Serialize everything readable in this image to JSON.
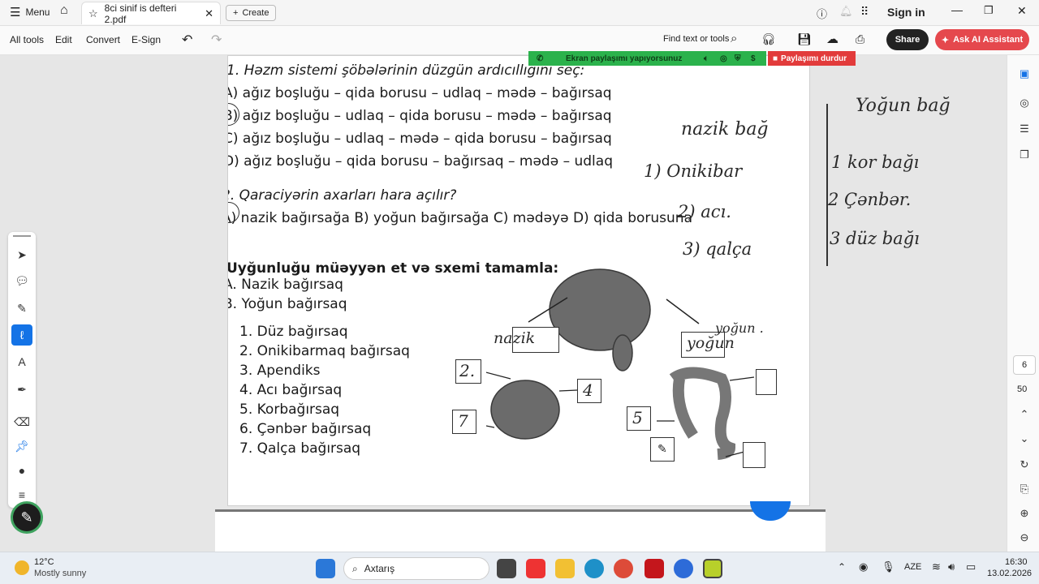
{
  "titlebar": {
    "menu_label": "Menu",
    "tab_title": "8ci sinif is defteri 2.pdf",
    "create_label": "Create",
    "sign_in": "Sign in"
  },
  "toolbar": {
    "all_tools": "All tools",
    "edit": "Edit",
    "convert": "Convert",
    "esign": "E-Sign",
    "find": "Find text or tools",
    "share": "Share",
    "ask_ai": "Ask AI Assistant"
  },
  "share_banner": {
    "text": "Ekran paylaşımı yapıyorsunuz",
    "stop": "Paylaşımı durdur"
  },
  "document": {
    "q1": "1. Həzm sistemi şöbələrinin düzgün ardıcıllığını seç:",
    "q1a": "A) ağız boşluğu – qida borusu – udlaq – mədə – bağırsaq",
    "q1b": "B) ağız boşluğu –  udlaq – qida borusu – mədə – bağırsaq",
    "q1c": "C) ağız boşluğu – udlaq – mədə – qida borusu –  bağırsaq",
    "q1d": "D) ağız boşluğu – qida borusu – bağırsaq – mədə – udlaq",
    "q2": "2. Qaraciyərin axarları hara açılır?",
    "q2opts": "A) nazik bağırsağa   B) yoğun bağırsağa   C) mədəyə    D) qida borusuna",
    "q3": "Uyğunluğu müəyyən et və sxemi tamamla:",
    "cat_a": "A. Nazik bağırsaq",
    "cat_b": "B. Yoğun bağırsaq",
    "items": [
      "1. Düz bağırsaq",
      "2. Onikibarmaq bağırsaq",
      "3. Apendiks",
      "4. Acı bağırsaq",
      "5. Korbağırsaq",
      "6. Çənbər bağırsaq",
      "7. Qalça bağırsaq"
    ],
    "box_labels": {
      "nazik": "nazik",
      "yogun": "yoğun",
      "two": "2.",
      "seven": "7",
      "four": "4",
      "five": "5"
    },
    "handwriting": {
      "nazik_bag": "nazik bağ",
      "n1": "1) Onikibar",
      "n2": "2) acı.",
      "n3": "3) qalça",
      "yogun_bag": "Yoğun bağ",
      "y1": "1 kor bağı",
      "y2": "2 Çənbər.",
      "y3": "3 düz bağı",
      "yogun_note": "yoğun ."
    }
  },
  "rightrail": {
    "page_number": "6",
    "total_pages": "50"
  },
  "taskbar": {
    "weather_temp": "12°C",
    "weather_desc": "Mostly sunny",
    "search_placeholder": "Axtarış",
    "lang": "AZE",
    "time": "16:30",
    "date": "13.02.2026"
  }
}
